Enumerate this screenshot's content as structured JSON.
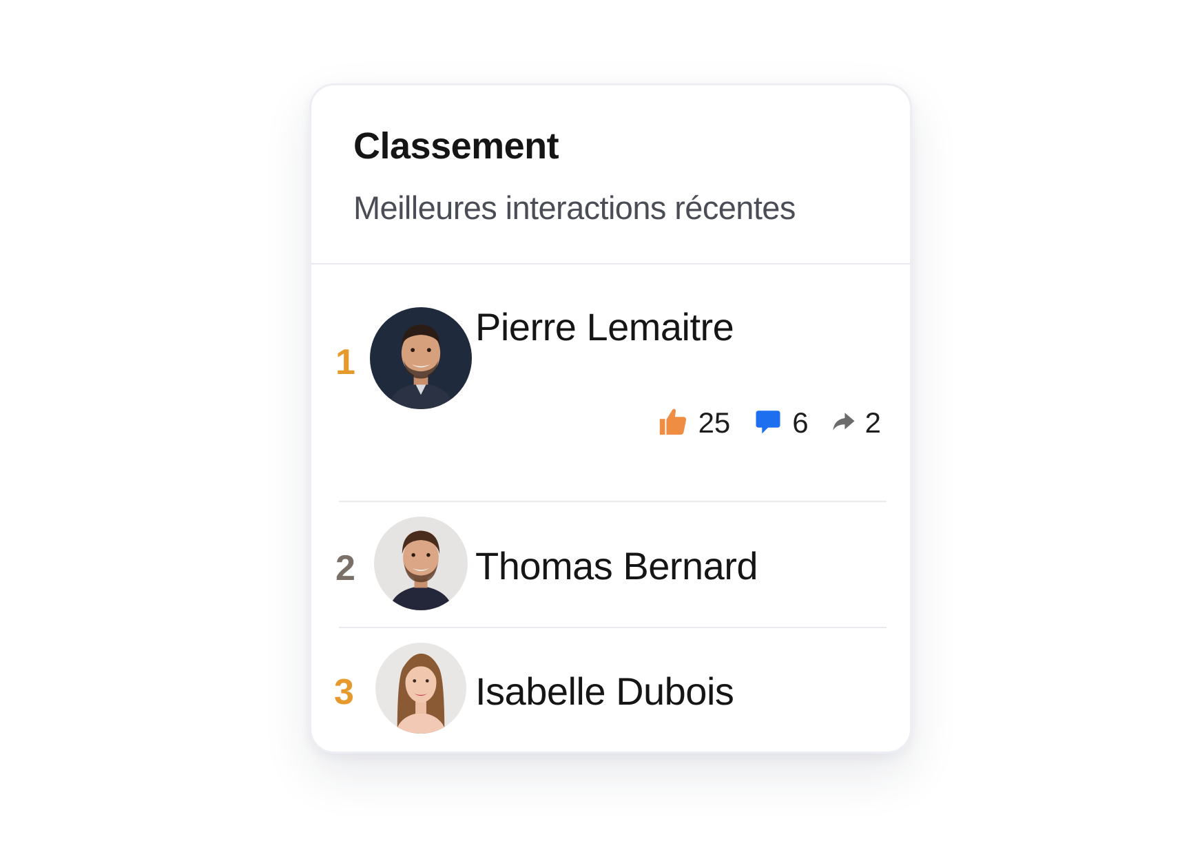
{
  "card": {
    "title": "Classement",
    "subtitle": "Meilleures interactions récentes"
  },
  "leaderboard": [
    {
      "rank": "1",
      "rank_color": "#e69a2e",
      "name": "Pierre Lemaitre",
      "stats": {
        "likes": "25",
        "comments": "6",
        "shares": "2"
      }
    },
    {
      "rank": "2",
      "rank_color": "#7a7068",
      "name": "Thomas Bernard"
    },
    {
      "rank": "3",
      "rank_color": "#e69a2e",
      "name": "Isabelle Dubois"
    }
  ],
  "icons": {
    "likes": "thumbs-up-icon",
    "comments": "comment-icon",
    "shares": "share-arrow-icon"
  },
  "colors": {
    "likes_icon": "#ef8d43",
    "comments_icon": "#1e6ff0",
    "shares_icon": "#6b6b6b"
  }
}
